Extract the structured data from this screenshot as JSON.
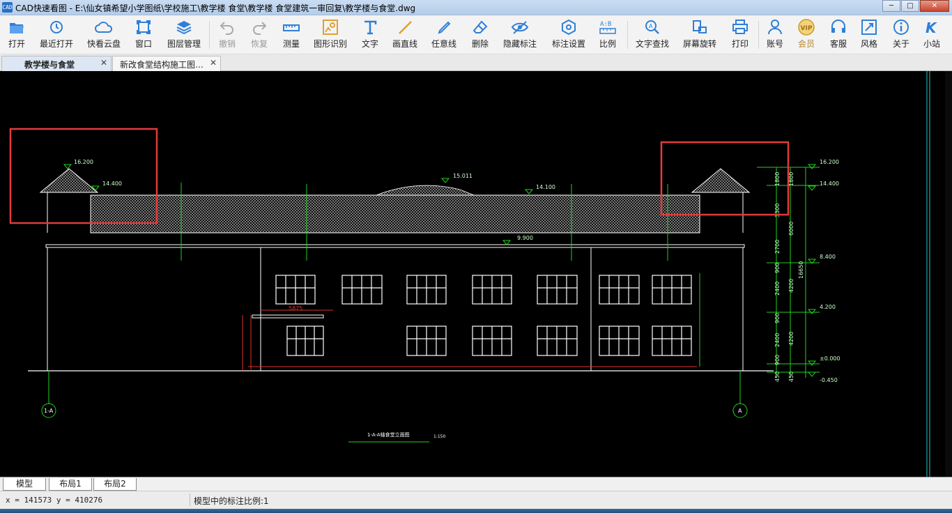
{
  "window": {
    "icon_text": "CAD",
    "title": "CAD快速看图 - E:\\仙女镇希望小学图纸\\学校施工\\教学楼 食堂\\教学楼 食堂建筑一审回复\\教学楼与食堂.dwg",
    "minimize": "─",
    "maximize": "□",
    "close": "✕"
  },
  "toolbar": [
    {
      "label": "打开",
      "icon": "folder-open-icon"
    },
    {
      "label": "最近打开",
      "icon": "history-icon"
    },
    {
      "label": "快看云盘",
      "icon": "cloud-icon"
    },
    {
      "label": "窗口",
      "icon": "window-icon"
    },
    {
      "label": "图层管理",
      "icon": "layers-icon"
    },
    {
      "label": "撤销",
      "icon": "undo-icon",
      "disabled": true
    },
    {
      "label": "恢复",
      "icon": "redo-icon",
      "disabled": true
    },
    {
      "label": "测量",
      "icon": "ruler-icon"
    },
    {
      "label": "图形识别",
      "icon": "shape-recognize-icon"
    },
    {
      "label": "文字",
      "icon": "text-icon"
    },
    {
      "label": "画直线",
      "icon": "line-icon"
    },
    {
      "label": "任意线",
      "icon": "pen-icon"
    },
    {
      "label": "删除",
      "icon": "eraser-icon"
    },
    {
      "label": "隐藏标注",
      "icon": "eye-hide-icon"
    },
    {
      "label": "标注设置",
      "icon": "annotation-settings-icon"
    },
    {
      "label": "比例",
      "icon": "scale-icon"
    },
    {
      "label": "文字查找",
      "icon": "text-search-icon"
    },
    {
      "label": "屏幕旋转",
      "icon": "rotate-screen-icon"
    },
    {
      "label": "打印",
      "icon": "printer-icon"
    },
    {
      "label": "账号",
      "icon": "user-icon"
    },
    {
      "label": "会员",
      "icon": "vip-icon",
      "vip": true
    },
    {
      "label": "客服",
      "icon": "headset-icon"
    },
    {
      "label": "风格",
      "icon": "style-icon"
    },
    {
      "label": "关于",
      "icon": "info-icon"
    },
    {
      "label": "小站",
      "icon": "k-site-icon"
    }
  ],
  "tabs": [
    {
      "label": "教学楼与食堂",
      "close": "✕",
      "active": true
    },
    {
      "label": "新改食堂结构施工图…",
      "close": "✕",
      "active": false
    }
  ],
  "layout_tabs": [
    "模型",
    "布局1",
    "布局2"
  ],
  "status": {
    "coords": "x = 141573  y = 410276",
    "scale": "模型中的标注比例:1"
  },
  "drawing": {
    "elev_labels": [
      "16.200",
      "14.400",
      "15.011",
      "14.100",
      "9.900",
      "16.200",
      "14.400",
      "8.400",
      "4.200",
      "±0.000",
      "-0.450"
    ],
    "axis_left": "1-A",
    "axis_right": "A",
    "drawing_title": "1-A-A轴食堂立面图",
    "drawing_scale": "1:150",
    "dim_5875": "5875",
    "dims_right_inner": [
      "1800",
      "3300",
      "2700",
      "900",
      "2400",
      "900",
      "2400",
      "900",
      "450"
    ],
    "dims_right_mid": [
      "1800",
      "6000",
      "4200",
      "4200",
      "450"
    ],
    "dims_right_total": "16650",
    "colors": {
      "annotation_red": "#e33b3b",
      "line_green": "#1fd21f",
      "dim_red": "#ff3030"
    }
  }
}
